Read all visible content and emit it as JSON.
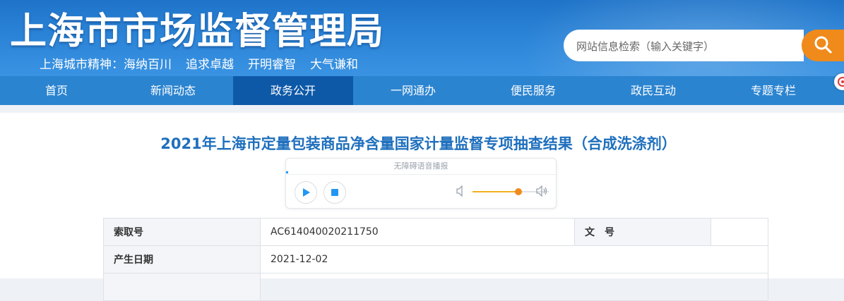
{
  "header": {
    "site_title": "上海市市场监督管理局",
    "slogan": [
      "上海城市精神：海纳百川",
      "追求卓越",
      "开明睿智",
      "大气谦和"
    ],
    "search": {
      "placeholder": "网站信息检索（输入关键字）",
      "button_icon": "search-icon"
    }
  },
  "nav": {
    "items": [
      {
        "label": "首页"
      },
      {
        "label": "新闻动态"
      },
      {
        "label": "政务公开",
        "active": true
      },
      {
        "label": "一网通办"
      },
      {
        "label": "便民服务"
      },
      {
        "label": "政民互动"
      },
      {
        "label": "专题专栏"
      }
    ]
  },
  "article": {
    "title": "2021年上海市定量包装商品净含量国家计量监督专项抽查结果（合成洗涤剂）"
  },
  "player": {
    "label": "无障碍语音播报",
    "volume_level": 0.6,
    "accent": "#f08a1a"
  },
  "info": {
    "rows": [
      {
        "label": "索取号",
        "value": "AC614040020211750",
        "label2": "文　号",
        "value2": ""
      },
      {
        "label": "产生日期",
        "value": "2021-12-02"
      }
    ]
  },
  "colors": {
    "header_blue": "#2d86d9",
    "nav_active": "#0d59a8",
    "search_button": "#ef8a1b",
    "title_blue": "#1e6fbd"
  }
}
